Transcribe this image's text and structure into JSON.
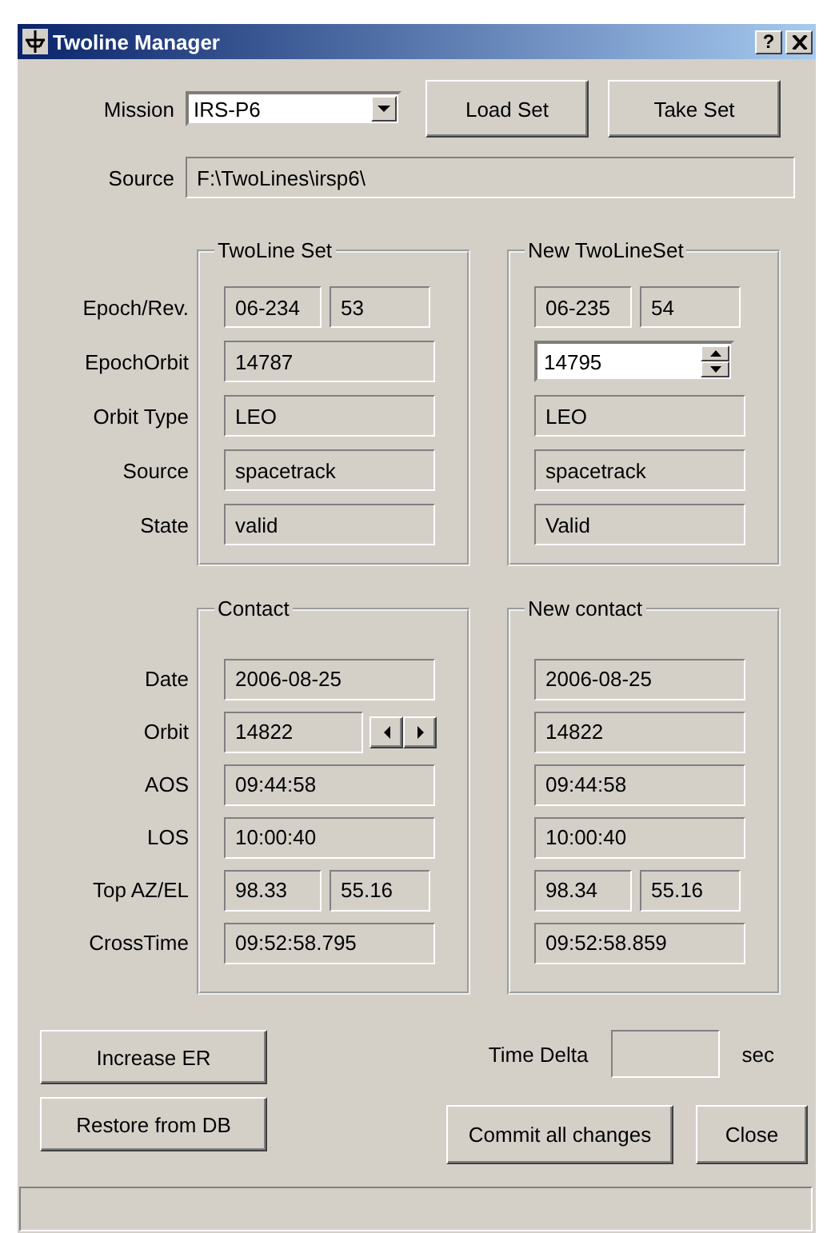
{
  "window": {
    "title": "Twoline Manager",
    "help_button": "?"
  },
  "mission": {
    "label": "Mission",
    "value": "IRS-P6"
  },
  "top_buttons": [
    "Load Set",
    "Take Set"
  ],
  "source": {
    "label": "Source",
    "value": "F:\\TwoLines\\irsp6\\"
  },
  "sections": [
    {
      "kind": "twoline",
      "row_labels": [
        "Epoch/Rev.",
        "EpochOrbit",
        "Orbit Type",
        "Source",
        "State"
      ],
      "groups": [
        {
          "title": "TwoLine Set",
          "rows": [
            {
              "kind": "pair",
              "values": [
                "06-234",
                "53"
              ]
            },
            {
              "kind": "text",
              "value": "14787"
            },
            {
              "kind": "text",
              "value": "LEO"
            },
            {
              "kind": "text",
              "value": "spacetrack"
            },
            {
              "kind": "text",
              "value": "valid"
            }
          ]
        },
        {
          "title": "New TwoLineSet",
          "rows": [
            {
              "kind": "pair",
              "values": [
                "06-235",
                "54"
              ]
            },
            {
              "kind": "spin",
              "value": "14795"
            },
            {
              "kind": "text",
              "value": "LEO"
            },
            {
              "kind": "text",
              "value": "spacetrack"
            },
            {
              "kind": "text",
              "value": "Valid"
            }
          ]
        }
      ]
    },
    {
      "kind": "contact",
      "row_labels": [
        "Date",
        "Orbit",
        "AOS",
        "LOS",
        "Top AZ/EL",
        "CrossTime"
      ],
      "groups": [
        {
          "title": "Contact",
          "rows": [
            {
              "kind": "text",
              "value": "2006-08-25"
            },
            {
              "kind": "stepper",
              "value": "14822"
            },
            {
              "kind": "text",
              "value": "09:44:58"
            },
            {
              "kind": "text",
              "value": "10:00:40"
            },
            {
              "kind": "pair",
              "values": [
                "98.33",
                "55.16"
              ]
            },
            {
              "kind": "text",
              "value": "09:52:58.795"
            }
          ]
        },
        {
          "title": "New contact",
          "rows": [
            {
              "kind": "text",
              "value": "2006-08-25"
            },
            {
              "kind": "text",
              "value": "14822"
            },
            {
              "kind": "text",
              "value": "09:44:58"
            },
            {
              "kind": "text",
              "value": "10:00:40"
            },
            {
              "kind": "pair",
              "values": [
                "98.34",
                "55.16"
              ]
            },
            {
              "kind": "text",
              "value": "09:52:58.859"
            }
          ]
        }
      ]
    }
  ],
  "left_buttons": [
    "Increase ER",
    "Restore from DB"
  ],
  "time_delta": {
    "label": "Time Delta",
    "unit": "sec"
  },
  "right_buttons": [
    "Commit all changes",
    "Close"
  ]
}
